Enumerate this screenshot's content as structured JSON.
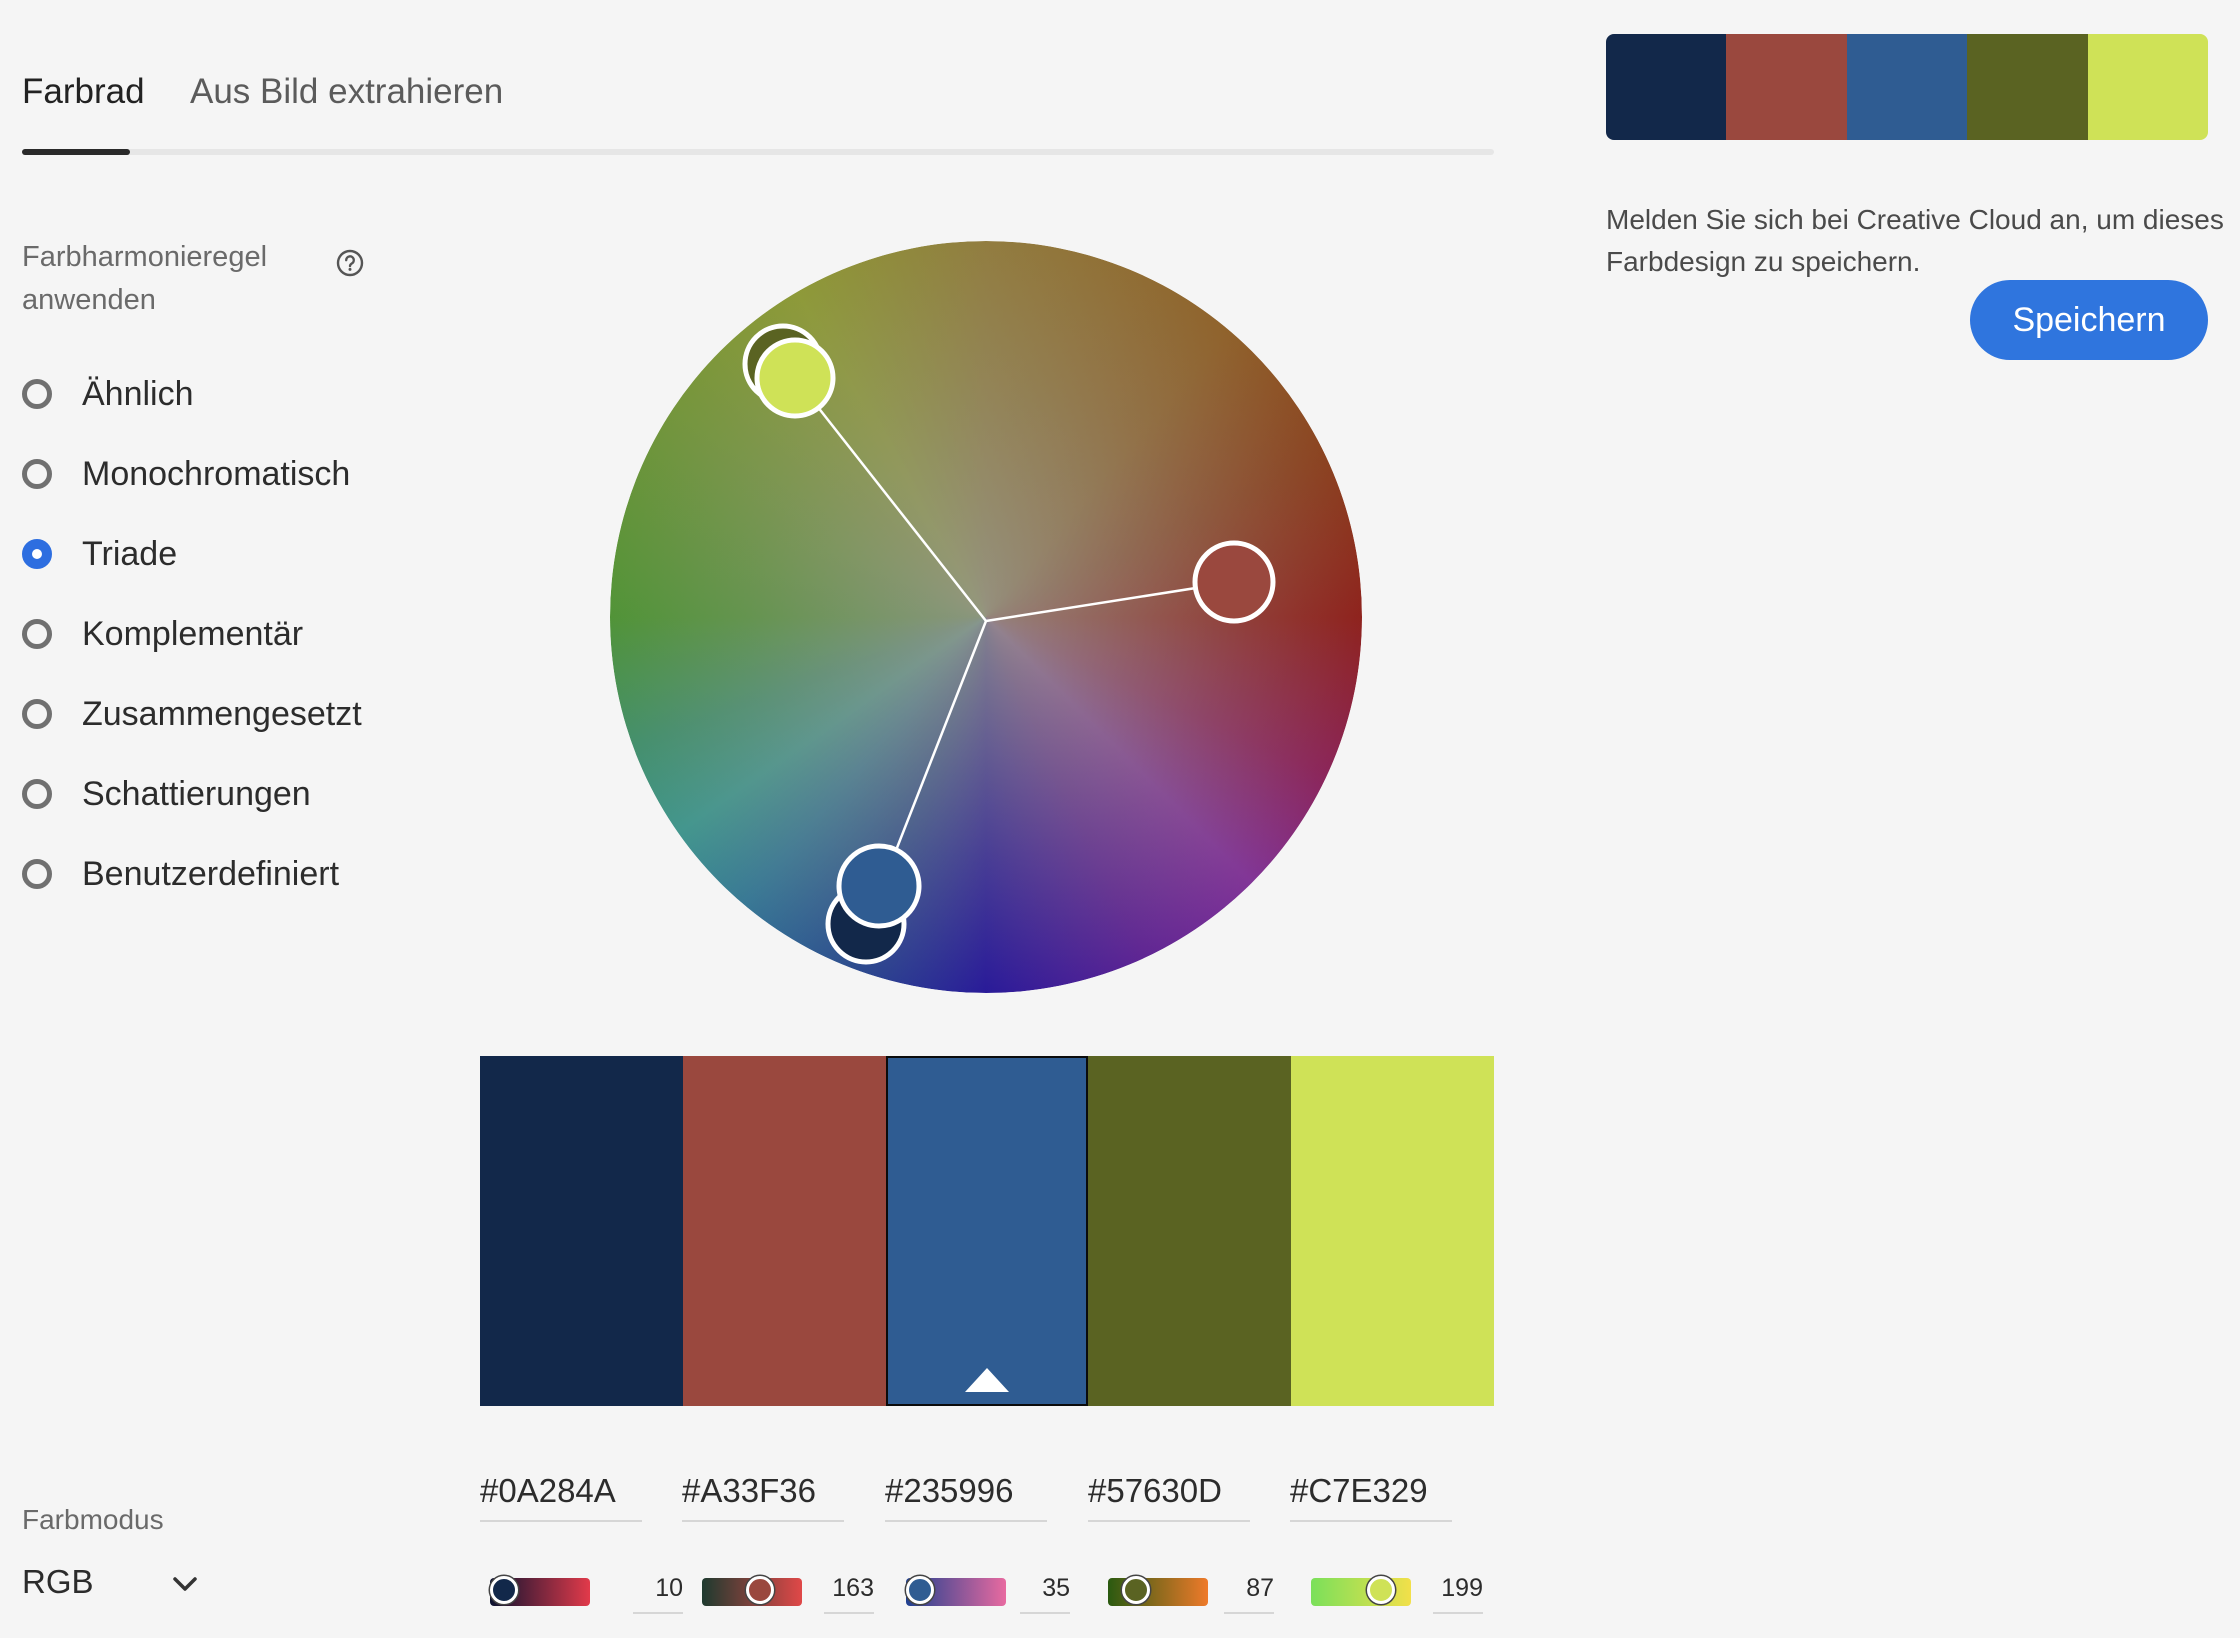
{
  "tabs": [
    {
      "label": "Farbrad",
      "active": true
    },
    {
      "label": "Aus Bild extrahieren",
      "active": false
    }
  ],
  "harmony": {
    "heading": "Farbharmonieregel anwenden",
    "help_icon": "question-circle-icon",
    "selected": "Triade",
    "rules": [
      "Ähnlich",
      "Monochromatisch",
      "Triade",
      "Komplementär",
      "Zusammengesetzt",
      "Schattierungen",
      "Benutzerdefiniert"
    ]
  },
  "swatches": [
    {
      "hex": "#0A284A",
      "value": "10",
      "color": "#12284a"
    },
    {
      "hex": "#A33F36",
      "value": "163",
      "color": "#9a483e"
    },
    {
      "hex": "#235996",
      "value": "35",
      "color": "#2f5c92",
      "selected": true
    },
    {
      "hex": "#57630D",
      "value": "87",
      "color": "#5a6322"
    },
    {
      "hex": "#C7E329",
      "value": "199",
      "color": "#cfe257"
    }
  ],
  "color_mode": {
    "label": "Farbmodus",
    "value": "RGB",
    "icon": "chevron-down-icon"
  },
  "right_panel": {
    "message": "Melden Sie sich bei Creative Cloud an, um dieses Farbdesign zu speichern.",
    "save_button": "Speichern"
  },
  "colors": {
    "accent": "#2d6ee0",
    "button": "#2f75de"
  }
}
